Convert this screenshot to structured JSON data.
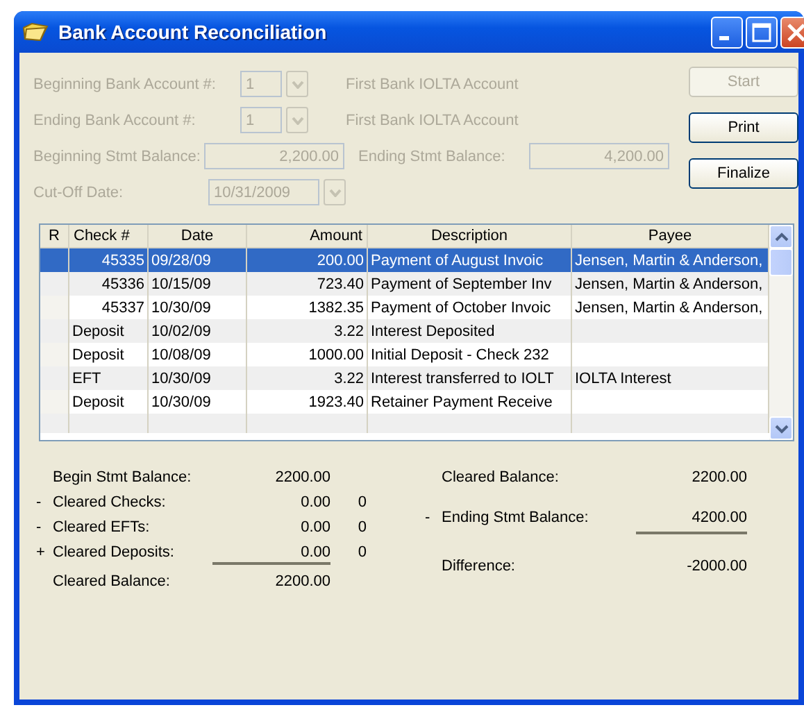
{
  "window": {
    "title": "Bank Account Reconciliation"
  },
  "form": {
    "beginning_account": {
      "label": "Beginning Bank Account #:",
      "value": "1",
      "name": "First Bank IOLTA Account",
      "disabled": true
    },
    "ending_account": {
      "label": "Ending Bank Account #:",
      "value": "1",
      "name": "First Bank IOLTA Account",
      "disabled": true
    },
    "beginning_balance": {
      "label": "Beginning Stmt Balance:",
      "value": "2,200.00",
      "disabled": true
    },
    "ending_balance": {
      "label": "Ending Stmt Balance:",
      "value": "4,200.00",
      "disabled": true
    },
    "cutoff_date": {
      "label": "Cut-Off Date:",
      "value": "10/31/2009",
      "disabled": true
    }
  },
  "buttons": [
    {
      "label": "Start",
      "disabled": true
    },
    {
      "label": "Print",
      "disabled": false
    },
    {
      "label": "Finalize",
      "disabled": false
    }
  ],
  "table": {
    "columns": [
      "R",
      "Check #",
      "Date",
      "Amount",
      "Description",
      "Payee"
    ],
    "rows": [
      {
        "selected": true,
        "cells": [
          "",
          "45335",
          "09/28/09",
          "200.00",
          "Payment of August Invoic",
          "Jensen, Martin & Anderson,"
        ]
      },
      {
        "selected": false,
        "cells": [
          "",
          "45336",
          "10/15/09",
          "723.40",
          "Payment of September Inv",
          "Jensen, Martin & Anderson,"
        ]
      },
      {
        "selected": false,
        "cells": [
          "",
          "45337",
          "10/30/09",
          "1382.35",
          "Payment of October Invoic",
          "Jensen, Martin & Anderson,"
        ]
      },
      {
        "selected": false,
        "cells": [
          "",
          "Deposit",
          "10/02/09",
          "3.22",
          "Interest Deposited",
          ""
        ]
      },
      {
        "selected": false,
        "cells": [
          "",
          "Deposit",
          "10/08/09",
          "1000.00",
          "Initial Deposit - Check 232",
          ""
        ]
      },
      {
        "selected": false,
        "cells": [
          "",
          "EFT",
          "10/30/09",
          "3.22",
          "Interest transferred to IOLT",
          "IOLTA Interest"
        ]
      },
      {
        "selected": false,
        "cells": [
          "",
          "Deposit",
          "10/30/09",
          "1923.40",
          "Retainer Payment Receive",
          ""
        ]
      }
    ]
  },
  "summary_left": [
    {
      "label": "Begin Stmt Balance:",
      "value": "2200.00",
      "underline": false
    },
    {
      "sign": "-",
      "label": "Cleared Checks:",
      "value": "0.00",
      "count": "0",
      "underline": false
    },
    {
      "sign": "-",
      "label": "Cleared EFTs:",
      "value": "0.00",
      "count": "0",
      "underline": false
    },
    {
      "sign": "+",
      "label": "Cleared Deposits:",
      "value": "0.00",
      "count": "0",
      "underline": true
    },
    {
      "label": "Cleared Balance:",
      "value": "2200.00",
      "underline": false
    }
  ],
  "summary_right": [
    {
      "label": "Cleared Balance:",
      "value": "2200.00",
      "underline": false
    },
    {
      "sign": "-",
      "label": "Ending Stmt Balance:",
      "value": "4200.00",
      "underline": true
    },
    {
      "label": "Difference:",
      "value": "-2000.00",
      "underline": false
    }
  ]
}
